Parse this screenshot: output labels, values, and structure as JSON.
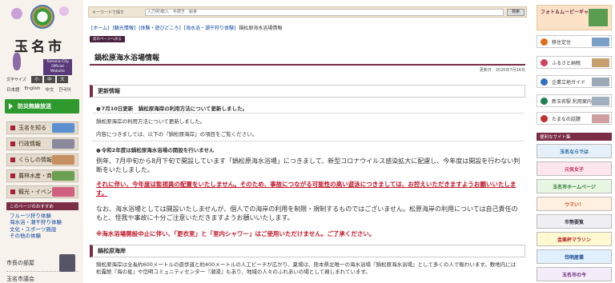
{
  "logo": {
    "city_name": "玉名市",
    "official_lines": [
      "Tamana City",
      "Official Website"
    ]
  },
  "font_size": {
    "label": "文字サイズ",
    "options": [
      "小",
      "中",
      "大"
    ]
  },
  "languages": [
    "日本語",
    "English",
    "中文",
    "한국어"
  ],
  "disaster_button": "防災無線放送",
  "side_nav": [
    "玉名を知る",
    "行政情報",
    "くらしの情報",
    "農林水産・商工業",
    "観光・イベント"
  ],
  "recommend": {
    "heading": "このページのおすすめ",
    "items": [
      "フルーツ狩り体験",
      "海水浴・潮干狩り体験",
      "文化・スポーツ施設",
      "その他の体験"
    ]
  },
  "mayor_label": "市長の部屋",
  "council_label": "玉名市議会",
  "search": {
    "keyword_label": "キーワードで探す",
    "placeholder": "入力例)転入　手続き　給食",
    "button": "検索"
  },
  "breadcrumb": [
    "[ホーム]",
    "[観光情報]",
    "[体験・遊びどころ]",
    "[海水浴・潮干狩り体験]",
    "鍋松原海水浴場情報"
  ],
  "page_tag": "前のページへ戻る",
  "title": "鍋松原海水浴場情報",
  "updated": "更新日：2020年7月16日",
  "sections": {
    "update_heading": "更新情報",
    "update_title": "7月10日更新　鍋松原海岸の利用方法について更新しました。",
    "update_body1": "鍋松原海岸の利用方法について更新しました。",
    "update_body2": "内容につきましては、以下の『鍋松原海岸』の項目をご覧ください。",
    "notice_title": "令和2年度は鍋松原海水浴場の開設を行いません",
    "notice_body": "例年、7月中旬から8月下旬で開設しています「鍋松原海水浴場」につきまして、新型コロナウイルス感染拡大に配慮し、今年度は開設を行わない判断をいたしました。",
    "notice_red": "それに伴い、今年度は監視員の配置をいたしません。そのため、事故につながる可能性の高い遊泳につきましては、お控えいただきますようお願いいたします。",
    "notice_body2": "なお、海水浴場としては開設いたしませんが、個人での海岸の利用を制限・規制するものではございません。松原海岸の利用については自己責任のもと、怪我や事故に十分ご注意いただきますようお願いいたします。",
    "notice_red2": "※海水浴場開設中止に伴い、「更衣室」と「室内シャワー」はご使用いただけません。ご了承ください。",
    "beach_heading": "鍋松原海岸",
    "beach_body": "鍋松原海岸は全長約600メートルの遊歩道と約400メートルの人工ビーチが広がり、夏場は、熊本県北唯一の海水浴場『鍋松原海水浴場』として多くの人で賑わいます。敷地内には松露館『海の星』や岱明コミュニティセンター『潮湯』もあり、地域の人々のふれあいの場として親しまれています。"
  },
  "right": {
    "gallery": "フォト＆ムービーギャラリー",
    "buttons": [
      "移住定住",
      "ふるさと納税",
      "企業立地ガイド",
      "新玉名駅 利用案内",
      "たまなの話題"
    ],
    "links_head": "便利なサイト集",
    "banners": [
      "玉名ならでは",
      "元気女子",
      "玉名市ホームページ",
      "ウマい！",
      "市勢要覧",
      "金栗杯マラソン",
      "岱明産業",
      "日本遺産",
      "玉名市の今"
    ]
  },
  "colors": {
    "accent": "#7b2d46",
    "green": "#2e9a2e",
    "link": "#0b44a0",
    "warning": "#c0182a"
  }
}
